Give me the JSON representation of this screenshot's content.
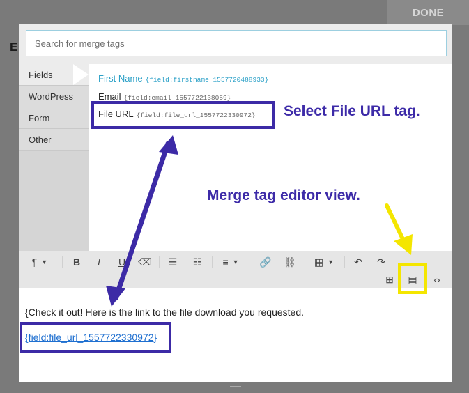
{
  "background": {
    "done_label": "DONE",
    "partial_heading": "E"
  },
  "search": {
    "placeholder": "Search for merge tags",
    "value": ""
  },
  "sidebar": {
    "items": [
      {
        "label": "Fields",
        "active": true
      },
      {
        "label": "WordPress",
        "active": false
      },
      {
        "label": "Form",
        "active": false
      },
      {
        "label": "Other",
        "active": false
      }
    ]
  },
  "tags": [
    {
      "label": "First Name",
      "code": "{field:firstname_1557720488933}"
    },
    {
      "label": "Email",
      "code": "{field:email_1557722138059}"
    },
    {
      "label": "File URL",
      "code": "{field:file_url_1557722330972}"
    }
  ],
  "toolbar": {
    "row1": [
      {
        "icon": "paragraph-icon",
        "glyph": "¶",
        "caret": true
      },
      {
        "icon": "bold-icon",
        "glyph": "B"
      },
      {
        "icon": "italic-icon",
        "glyph": "I"
      },
      {
        "icon": "underline-icon",
        "glyph": "U"
      },
      {
        "icon": "eraser-icon",
        "glyph": "⌫"
      },
      {
        "icon": "ordered-list-icon",
        "glyph": "☰"
      },
      {
        "icon": "unordered-list-icon",
        "glyph": "☷"
      },
      {
        "icon": "align-icon",
        "glyph": "≡",
        "caret": true
      },
      {
        "icon": "link-icon",
        "glyph": "🔗"
      },
      {
        "icon": "unlink-icon",
        "glyph": "⛓"
      },
      {
        "icon": "table-icon",
        "glyph": "▦",
        "caret": true
      },
      {
        "icon": "undo-icon",
        "glyph": "↶"
      },
      {
        "icon": "redo-icon",
        "glyph": "↷"
      }
    ],
    "row2": [
      {
        "icon": "merge-tag-icon",
        "glyph": "⊞"
      },
      {
        "icon": "merge-tag-editor-icon",
        "glyph": "▤"
      },
      {
        "icon": "code-view-icon",
        "glyph": "‹›"
      }
    ]
  },
  "editor": {
    "line1": "{Check it out! Here is the link to the file download you requested.",
    "tag": "{field:file_url_1557722330972}"
  },
  "annotations": {
    "select_tag": "Select File URL tag.",
    "editor_view": "Merge tag editor view."
  },
  "colors": {
    "annotation_purple": "#3c2aa6",
    "annotation_yellow": "#f4e600",
    "tag_blue": "#2aa0c7"
  }
}
